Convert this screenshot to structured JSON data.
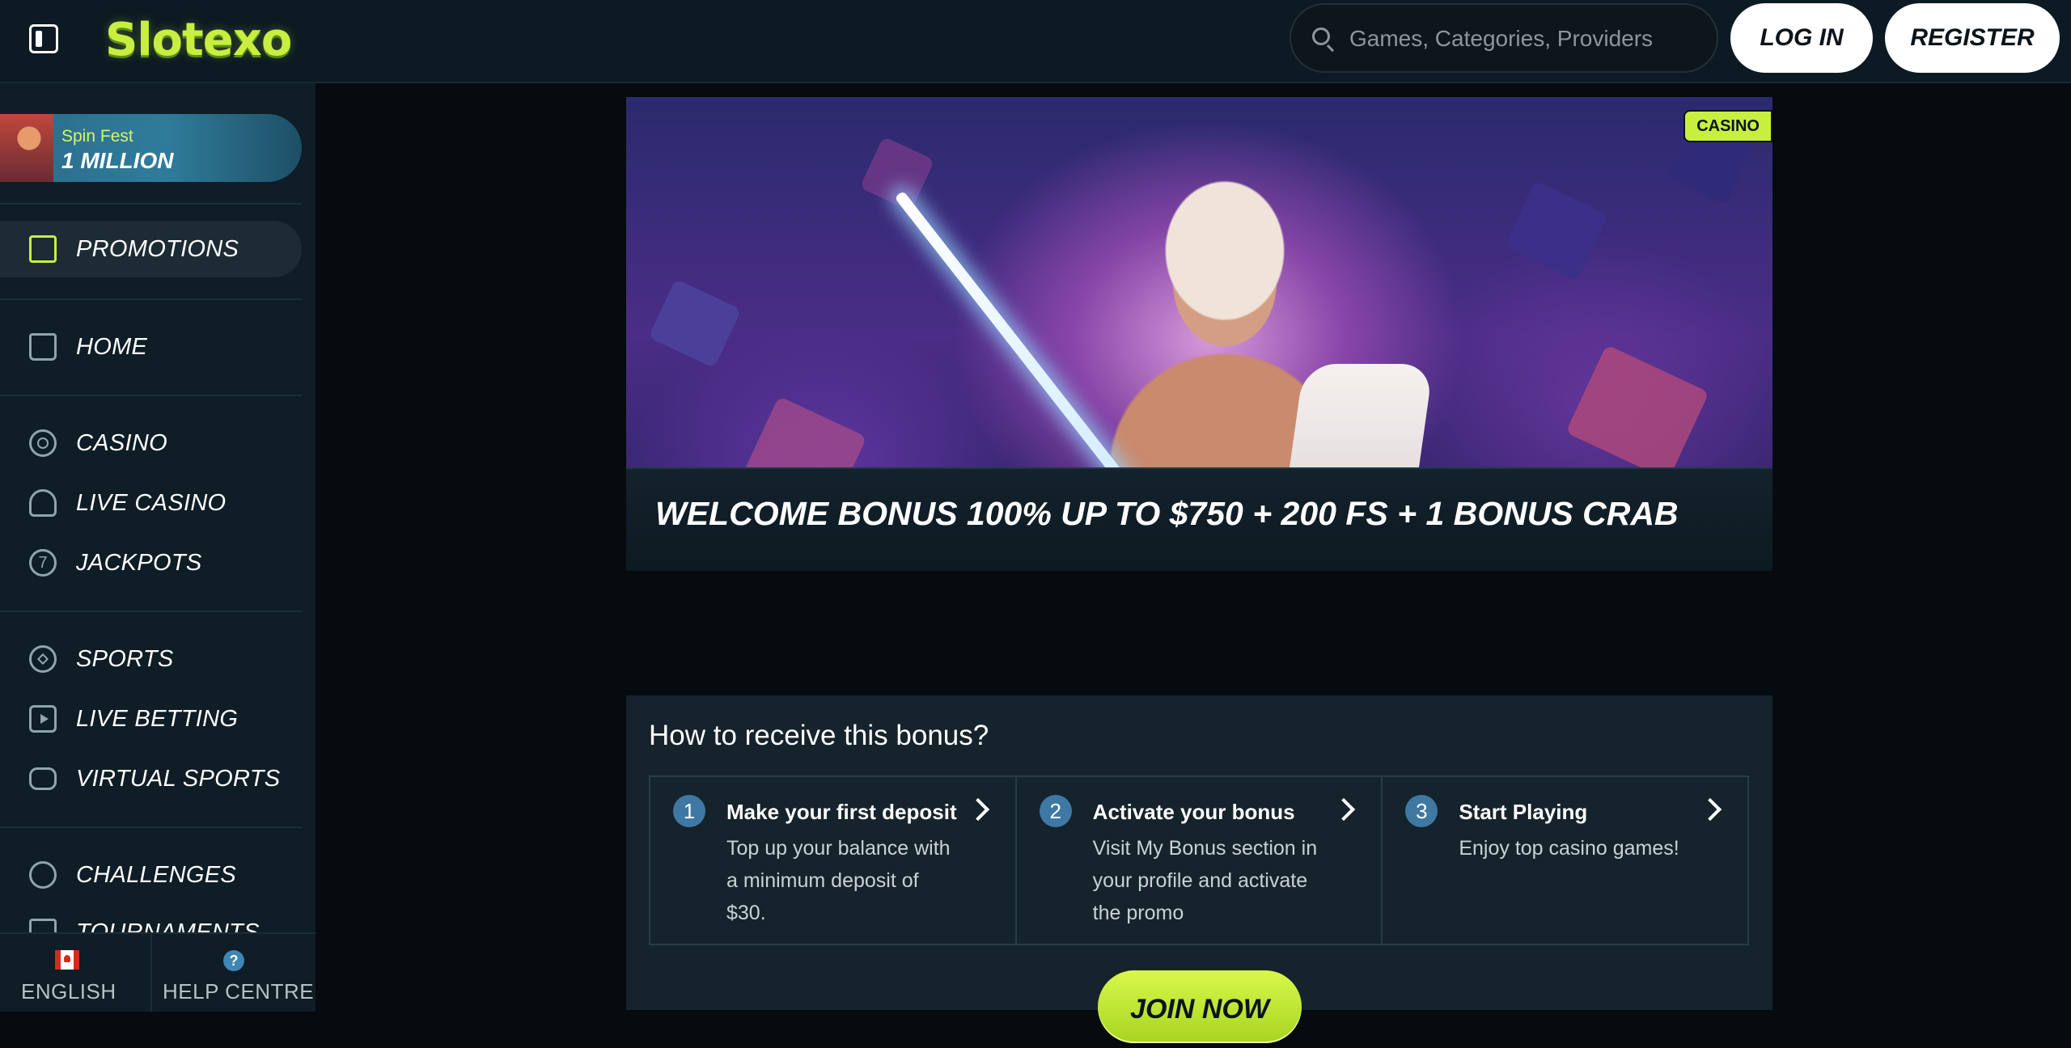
{
  "header": {
    "brand": "Slotexo",
    "search_placeholder": "Games, Categories, Providers",
    "login_label": "LOG IN",
    "register_label": "REGISTER",
    "accent_color": "#c8ef3f"
  },
  "sidebar": {
    "banner": {
      "title": "Spin Fest",
      "amount": "1 MILLION"
    },
    "promotions_label": "PROMOTIONS",
    "items": {
      "home": "HOME",
      "casino": "CASINO",
      "live_casino": "LIVE CASINO",
      "jackpots": "JACKPOTS",
      "jackpots_glyph": "7",
      "sports": "SPORTS",
      "live_betting": "LIVE BETTING",
      "virtual_sports": "VIRTUAL SPORTS",
      "challenges": "CHALLENGES",
      "tournaments": "TOURNAMENTS"
    },
    "footer": {
      "language": "ENGLISH",
      "help": "HELP CENTRE",
      "help_glyph": "?"
    }
  },
  "promo": {
    "badge": "CASINO",
    "title": "WELCOME BONUS 100% UP TO $750 + 200 FS + 1 BONUS CRAB",
    "how_heading": "How to receive this bonus?",
    "steps": [
      {
        "number": "1",
        "title": "Make your first deposit",
        "description": "Top up your balance with a minimum deposit of $30."
      },
      {
        "number": "2",
        "title": "Activate your bonus",
        "description": "Visit My Bonus section in your profile and activate the promo"
      },
      {
        "number": "3",
        "title": "Start Playing",
        "description": "Enjoy top casino games!"
      }
    ],
    "cta_label": "JOIN NOW"
  }
}
